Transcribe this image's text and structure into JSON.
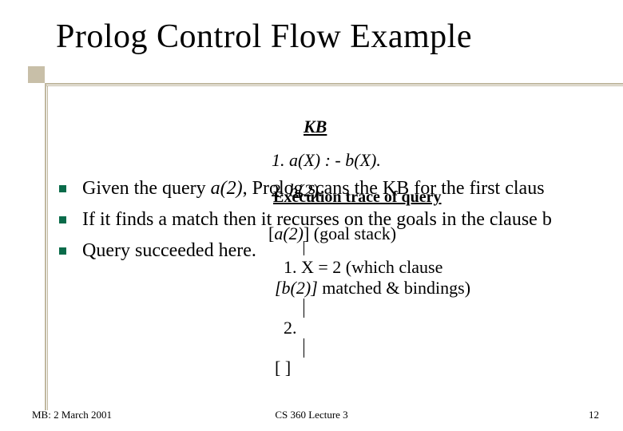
{
  "title": "Prolog Control Flow Example",
  "kb": {
    "heading": "KB",
    "rule1": "1. a(X) : - b(X).",
    "rule2": "2. b(2)."
  },
  "trace": {
    "heading": "Execution trace of query",
    "goal_stack_bracket": "[",
    "goal_stack_term": "a(2)",
    "goal_stack_close": "] (goal stack)",
    "step1_text": "1. X = 2 (which clause",
    "step1b_bracket": "[b(2)]",
    "step1b_note": "    matched & bindings)",
    "step2": "2.",
    "empty": "[ ]"
  },
  "bullets": {
    "b1_pre": "Given the query ",
    "b1_query": "a(2)",
    "b1_post": ", Prolog scans the KB for the first claus",
    "b2": "If it finds a match then it recurses on the goals in the clause b",
    "b3": "Query succeeded here."
  },
  "footer": {
    "left": "MB: 2 March 2001",
    "center": "CS 360 Lecture 3",
    "right": "12"
  }
}
